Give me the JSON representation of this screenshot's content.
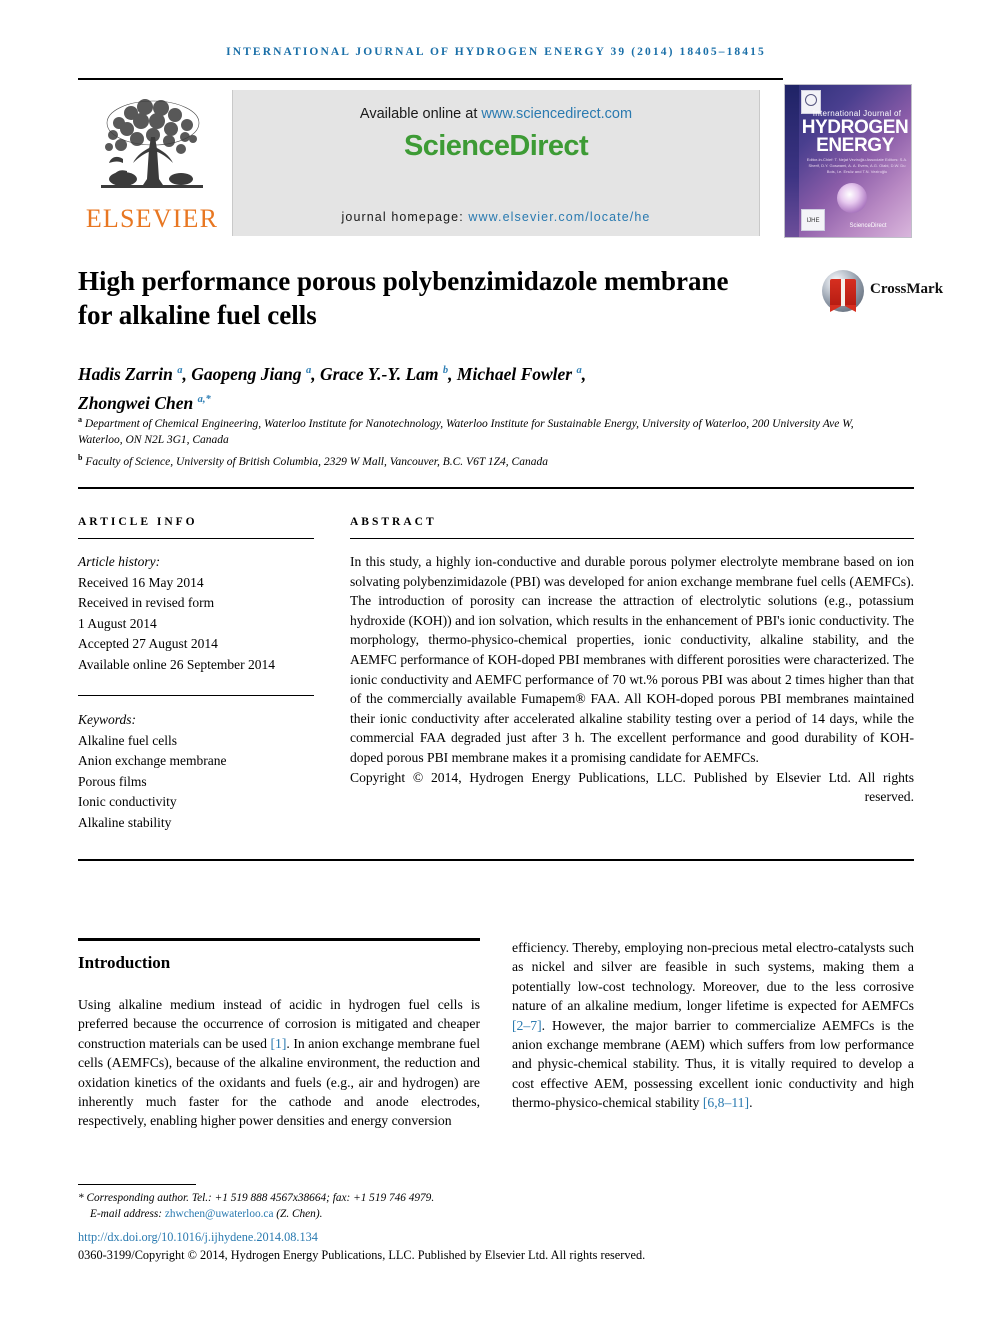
{
  "running_head": "International Journal of Hydrogen Energy 39 (2014) 18405–18415",
  "header": {
    "publisher_name": "ELSEVIER",
    "available_prefix": "Available online at ",
    "available_link": "www.sciencedirect.com",
    "sciencedirect_logo": "ScienceDirect",
    "homepage_prefix": "journal homepage: ",
    "homepage_link": "www.elsevier.com/locate/he"
  },
  "cover": {
    "line_small": "International Journal of",
    "line_big_1": "HYDROGEN",
    "line_big_2": "ENERGY",
    "editors": "Editor-in-Chief: T. Nejat Veziroğlu\nAssociate Editors: S.A. Sherif, D.Y. Goswami, A. A. Evers, A.G. Olabi, D.W. Du Bois, I.e. Ersöz and T.N. Veziroğlu",
    "badge": "IJHE",
    "sciencedirect": "ScienceDirect"
  },
  "crossmark": {
    "label": "CrossMark"
  },
  "article": {
    "title": "High performance porous polybenzimidazole membrane for alkaline fuel cells",
    "authors_line_1": "Hadis Zarrin ᵃ, Gaopeng Jiang ᵃ, Grace Y.-Y. Lam ᵇ, Michael Fowler ᵃ,",
    "authors_line_2": "Zhongwei Chen ᵃ,*",
    "authors": [
      {
        "name": "Hadis Zarrin",
        "marker": "a"
      },
      {
        "name": "Gaopeng Jiang",
        "marker": "a"
      },
      {
        "name": "Grace Y.-Y. Lam",
        "marker": "b"
      },
      {
        "name": "Michael Fowler",
        "marker": "a"
      },
      {
        "name": "Zhongwei Chen",
        "marker": "a,*"
      }
    ],
    "affiliation_a": "Department of Chemical Engineering, Waterloo Institute for Nanotechnology, Waterloo Institute for Sustainable Energy, University of Waterloo, 200 University Ave W, Waterloo, ON N2L 3G1, Canada",
    "affiliation_b": "Faculty of Science, University of British Columbia, 2329 W Mall, Vancouver, B.C. V6T 1Z4, Canada"
  },
  "article_info": {
    "heading": "ARTICLE INFO",
    "history_label": "Article history:",
    "history": [
      "Received 16 May 2014",
      "Received in revised form",
      "1 August 2014",
      "Accepted 27 August 2014",
      "Available online 26 September 2014"
    ],
    "keywords_label": "Keywords:",
    "keywords": [
      "Alkaline fuel cells",
      "Anion exchange membrane",
      "Porous films",
      "Ionic conductivity",
      "Alkaline stability"
    ]
  },
  "abstract": {
    "heading": "ABSTRACT",
    "text": "In this study, a highly ion-conductive and durable porous polymer electrolyte membrane based on ion solvating polybenzimidazole (PBI) was developed for anion exchange membrane fuel cells (AEMFCs). The introduction of porosity can increase the attraction of electrolytic solutions (e.g., potassium hydroxide (KOH)) and ion solvation, which results in the enhancement of PBI's ionic conductivity. The morphology, thermo-physico-chemical properties, ionic conductivity, alkaline stability, and the AEMFC performance of KOH-doped PBI membranes with different porosities were characterized. The ionic conductivity and AEMFC performance of 70 wt.% porous PBI was about 2 times higher than that of the commercially available Fumapem® FAA. All KOH-doped porous PBI membranes maintained their ionic conductivity after accelerated alkaline stability testing over a period of 14 days, while the commercial FAA degraded just after 3 h. The excellent performance and good durability of KOH-doped porous PBI membrane makes it a promising candidate for AEMFCs.",
    "copyright": "Copyright © 2014, Hydrogen Energy Publications, LLC. Published by Elsevier Ltd. All rights reserved."
  },
  "introduction": {
    "heading": "Introduction",
    "left_paragraph": "Using alkaline medium instead of acidic in hydrogen fuel cells is preferred because the occurrence of corrosion is mitigated and cheaper construction materials can be used [1]. In anion exchange membrane fuel cells (AEMFCs), because of the alkaline environment, the reduction and oxidation kinetics of the oxidants and fuels (e.g., air and hydrogen) are inherently much faster for the cathode and anode electrodes, respectively, enabling higher power densities and energy conversion",
    "right_paragraph": "efficiency. Thereby, employing non-precious metal electro-catalysts such as nickel and silver are feasible in such systems, making them a potentially low-cost technology. Moreover, due to the less corrosive nature of an alkaline medium, longer lifetime is expected for AEMFCs [2–7]. However, the major barrier to commercialize AEMFCs is the anion exchange membrane (AEM) which suffers from low performance and physic-chemical stability. Thus, it is vitally required to develop a cost effective AEM, possessing excellent ionic conductivity and high thermo-physico-chemical stability [6,8–11].",
    "references_inline": [
      "[1]",
      "[2–7]",
      "[6,8–11]"
    ]
  },
  "footer": {
    "corresponding_line": "* Corresponding author. Tel.: +1 519 888 4567x38664; fax: +1 519 746 4979.",
    "email_label": "E-mail address: ",
    "email": "zhwchen@uwaterloo.ca",
    "email_suffix": " (Z. Chen).",
    "doi": "http://dx.doi.org/10.1016/j.ijhydene.2014.08.134",
    "issn_copyright": "0360-3199/Copyright © 2014, Hydrogen Energy Publications, LLC. Published by Elsevier Ltd. All rights reserved."
  },
  "colors": {
    "link": "#2a7ab0",
    "elsevier_orange": "#E87722",
    "sciencedirect_green": "#3d9b35",
    "running_head_blue": "#1a6fa8"
  }
}
